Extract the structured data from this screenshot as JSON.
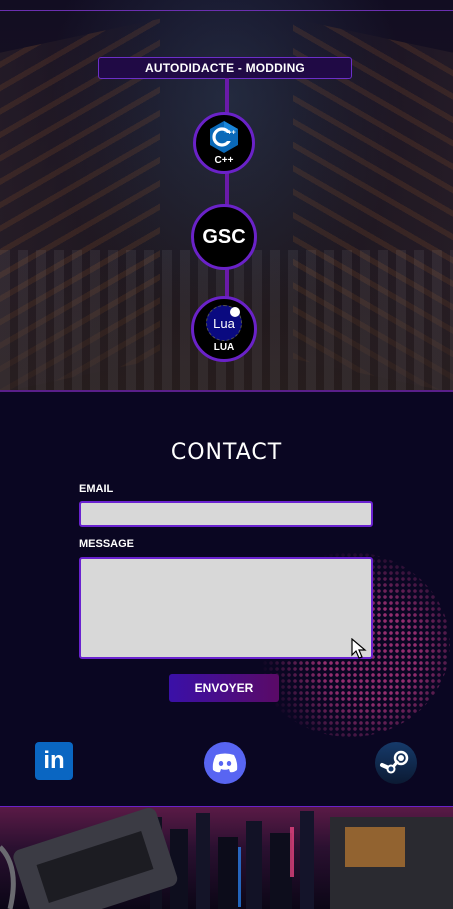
{
  "skills": {
    "title": "AUTODIDACTE - MODDING",
    "nodes": [
      {
        "name": "C++",
        "icon": "cpp-logo-icon"
      },
      {
        "name": "GSC",
        "icon": "gsc-text-icon"
      },
      {
        "name": "LUA",
        "icon": "lua-logo-icon",
        "logo_text": "Lua"
      }
    ]
  },
  "contact": {
    "title": "CONTACT",
    "email_label": "EMAIL",
    "email_value": "",
    "message_label": "MESSAGE",
    "message_value": "",
    "send_label": "ENVOYER"
  },
  "social": {
    "linkedin": {
      "icon": "linkedin-icon",
      "text": "in"
    },
    "discord": {
      "icon": "discord-icon"
    },
    "steam": {
      "icon": "steam-icon"
    }
  },
  "colors": {
    "accent": "#6a22c8",
    "background": "#0a0622",
    "button_start": "#3a10a8",
    "button_end": "#5a0a66"
  }
}
